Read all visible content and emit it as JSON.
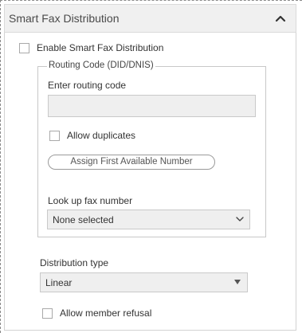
{
  "panel": {
    "title": "Smart Fax Distribution",
    "collapse_icon": "chevron-up-icon"
  },
  "enable_checkbox": {
    "label": "Enable Smart Fax Distribution",
    "checked": false
  },
  "routing": {
    "legend": "Routing Code (DID/DNIS)",
    "input_label": "Enter routing code",
    "input_value": "",
    "allow_duplicates": {
      "label": "Allow duplicates",
      "checked": false
    },
    "assign_button": "Assign First Available Number",
    "lookup_label": "Look up fax number",
    "lookup_selected": "None selected",
    "lookup_icon": "chevron-down-icon"
  },
  "distribution": {
    "label": "Distribution type",
    "selected": "Linear",
    "icon": "caret-down-icon"
  },
  "allow_member_refusal": {
    "label": "Allow member refusal",
    "checked": false
  },
  "colors": {
    "header_bg": "#f0f0f0",
    "input_bg": "#efefef",
    "border": "#c9c9c9",
    "text": "#333333"
  }
}
